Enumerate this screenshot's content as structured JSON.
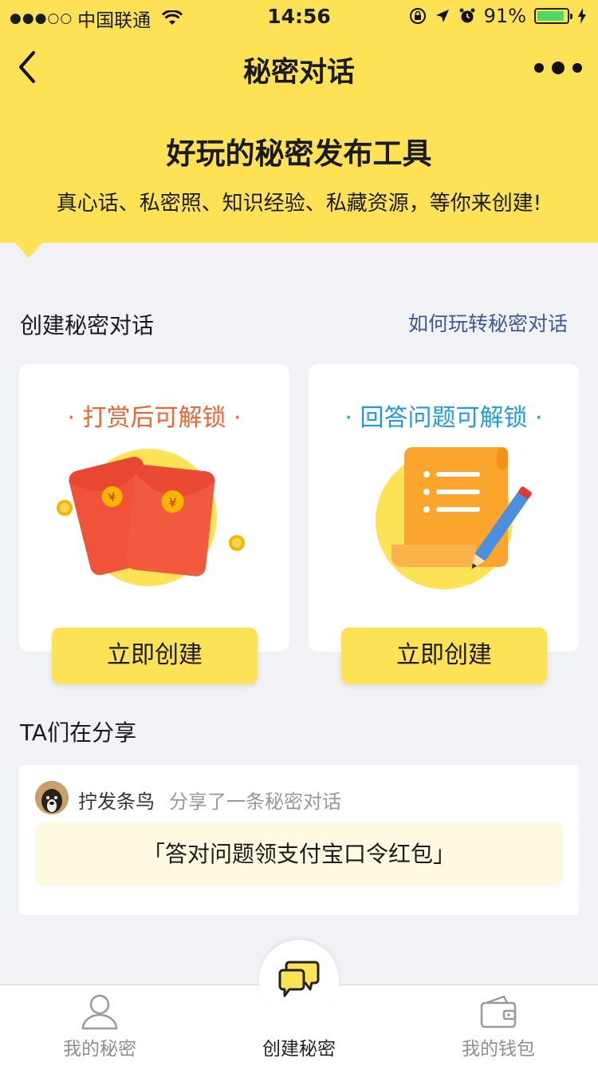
{
  "status_bar": {
    "carrier": "中国联通",
    "time": "14:56",
    "battery": "91%",
    "battery_level": 0.91
  },
  "nav": {
    "title": "秘密对话"
  },
  "hero": {
    "title": "好玩的秘密发布工具",
    "subtitle": "真心话、私密照、知识经验、私藏资源，等你来创建!"
  },
  "create_section": {
    "title": "创建秘密对话",
    "link": "如何玩转秘密对话"
  },
  "cards": [
    {
      "title": "· 打赏后可解锁 ·",
      "button": "立即创建",
      "accent": "#f4622e",
      "icon": "red-envelope-icon"
    },
    {
      "title": "· 回答问题可解锁 ·",
      "button": "立即创建",
      "accent": "#1f9be3",
      "icon": "scroll-pencil-icon"
    }
  ],
  "share_section": {
    "title": "TA们在分享",
    "items": [
      {
        "user": "拧发条鸟",
        "action": "分享了一条秘密对话",
        "quote": "「答对问题领支付宝口令红包」"
      }
    ]
  },
  "tabs": [
    {
      "label": "我的秘密",
      "icon": "user-icon"
    },
    {
      "label": "创建秘密",
      "icon": "chat-bubbles-icon"
    },
    {
      "label": "我的钱包",
      "icon": "wallet-icon"
    }
  ],
  "colors": {
    "brand_yellow": "#fde255",
    "link": "#3b5a96"
  }
}
